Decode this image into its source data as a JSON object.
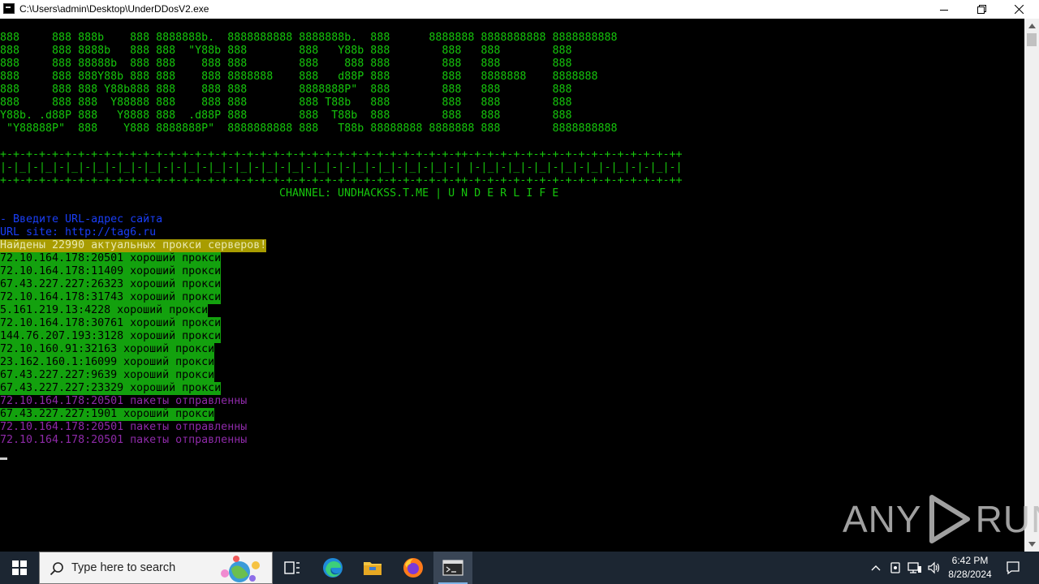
{
  "window": {
    "title": "C:\\Users\\admin\\Desktop\\UnderDDosV2.exe"
  },
  "console": {
    "banner": [
      "888     888 888b    888 8888888b.  8888888888 8888888b.  888      8888888 8888888888 8888888888",
      "888     888 8888b   888 888  \"Y88b 888        888   Y88b 888        888   888        888",
      "888     888 88888b  888 888    888 888        888    888 888        888   888        888",
      "888     888 888Y88b 888 888    888 8888888    888   d88P 888        888   8888888    8888888",
      "888     888 888 Y88b888 888    888 888        8888888P\"  888        888   888        888",
      "888     888 888  Y88888 888    888 888        888 T88b   888        888   888        888",
      "Y88b. .d88P 888   Y8888 888  .d88P 888        888  T88b  888        888   888        888",
      " \"Y88888P\"  888    Y888 8888888P\"  8888888888 888   T88b 88888888 8888888 888        8888888888"
    ],
    "border_top": "+-+-+-+-+-+-+-+-+-+-+-+-+-+-+-+-+-+-+-+-+-+-+-+-+-+-+-+-+-+-+-+-+-+-+-++-+-+-+-+-+-+-+-+-+-+-+-+-+-+-+-++",
    "border_mid": "|-|_|-|_|-|_|-|_|-|_|-|_|-|-|_|-|_|-|_|-|_|-|_|-|_|-|-|_|-|_|-|_|-|_|-| |-|_|-|_|-|_|-|_|-|_|-|_|-|-|_|-|",
    "border_bot": "+-+-+-+-+-+-+-+-+-+-+-+-+-+-+-+-+-+-+-+-+-+-+-+-+-+-+-+-+-+-+-+-+-+-+-++-+-+-+-+-+-+-+-+-+-+-+-+-+-+-+-++",
    "channel": "CHANNEL: UNDHACKSS.T.ME | U N D E R L I F E",
    "prompt": "- Введите URL-адрес сайта",
    "url_line": "URL site: http://tag6.ru",
    "found": "Найдены 22990 актуальных прокси серверов!",
    "results": [
      {
        "text": "72.10.164.178:20501 хороший прокси",
        "style": "good"
      },
      {
        "text": "72.10.164.178:11409 хороший прокси",
        "style": "good"
      },
      {
        "text": "67.43.227.227:26323 хороший прокси",
        "style": "good"
      },
      {
        "text": "72.10.164.178:31743 хороший прокси",
        "style": "good"
      },
      {
        "text": "5.161.219.13:4228 хороший прокси",
        "style": "good"
      },
      {
        "text": "72.10.164.178:30761 хороший прокси",
        "style": "good"
      },
      {
        "text": "144.76.207.193:3128 хороший прокси",
        "style": "good"
      },
      {
        "text": "72.10.160.91:32163 хороший прокси",
        "style": "good"
      },
      {
        "text": "23.162.160.1:16099 хороший прокси",
        "style": "good"
      },
      {
        "text": "67.43.227.227:9639 хороший прокси",
        "style": "good"
      },
      {
        "text": "67.43.227.227:23329 хороший прокси",
        "style": "good"
      },
      {
        "text": "72.10.164.178:20501 пакеты отправленны",
        "style": "sent"
      },
      {
        "text": "67.43.227.227:1901 хороший прокси",
        "style": "good"
      },
      {
        "text": "72.10.164.178:20501 пакеты отправленны",
        "style": "sent"
      },
      {
        "text": "72.10.164.178:20501 пакеты отправленны",
        "style": "sent"
      }
    ]
  },
  "watermark": {
    "left": "ANY",
    "right": "RUN"
  },
  "taskbar": {
    "search_placeholder": "Type here to search",
    "time": "6:42 PM",
    "date": "8/28/2024"
  },
  "icons": {
    "app": "console-app-icon",
    "minimize": "minimize-icon",
    "maximize": "restore-icon",
    "close": "close-icon",
    "start": "windows-start-icon",
    "search": "search-icon",
    "task_view": "task-view-icon",
    "edge": "edge-icon",
    "explorer": "folder-icon",
    "firefox": "firefox-icon",
    "terminal": "terminal-icon"
  },
  "colors": {
    "console_green": "#16c60c",
    "prompt_blue": "#1a3ef5",
    "found_bg": "#a89c00",
    "good_bg": "#13a10e",
    "sent_text": "#8e2aa8",
    "taskbar_bg": "#1c2632"
  }
}
